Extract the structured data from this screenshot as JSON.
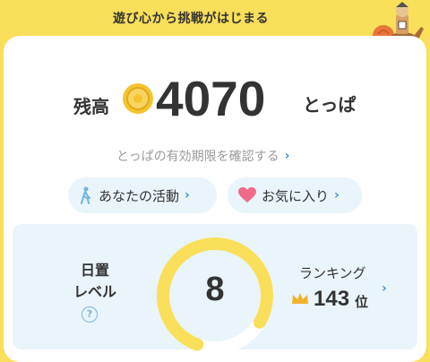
{
  "banner": {
    "text": "遊び心から挑戦がはじまる"
  },
  "balance": {
    "label": "残高",
    "value": "4070",
    "unit": "とっぱ"
  },
  "expiry_link": {
    "label": "とっぱの有効期限を確認する"
  },
  "buttons": {
    "activity": "あなたの活動",
    "favorites": "お気に入り"
  },
  "level": {
    "label_line1": "日置",
    "label_line2": "レベル",
    "help": "?",
    "value": "8",
    "progress_fraction": 0.78
  },
  "ranking": {
    "label": "ランキング",
    "value": "143",
    "suffix": "位"
  },
  "colors": {
    "banner": "#f9df5a",
    "gauge": "#f9df5a",
    "link_chevron": "#4a90c8",
    "panel": "#eaf4fb",
    "heart": "#f06b8a",
    "coin": "#f4c430"
  },
  "icons": {
    "coin": "coin-icon",
    "walk": "walking-person-icon",
    "heart": "heart-icon",
    "crown": "crown-icon",
    "help": "question-circle-icon",
    "mascot": "mascot-illustration"
  }
}
